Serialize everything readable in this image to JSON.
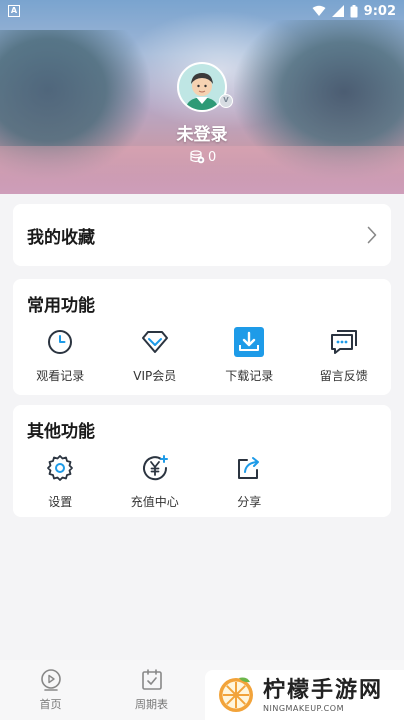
{
  "status_bar": {
    "time": "9:02",
    "left_icon_letter": "A",
    "icons": [
      "notification-A-icon",
      "wifi-icon",
      "signal-icon",
      "battery-icon"
    ]
  },
  "profile": {
    "username": "未登录",
    "coin_count": "0",
    "avatar_badge": "V"
  },
  "favorites": {
    "title": "我的收藏"
  },
  "common_functions": {
    "title": "常用功能",
    "items": [
      {
        "label": "观看记录",
        "icon": "clock-icon"
      },
      {
        "label": "VIP会员",
        "icon": "diamond-icon"
      },
      {
        "label": "下载记录",
        "icon": "download-icon"
      },
      {
        "label": "留言反馈",
        "icon": "message-icon"
      }
    ]
  },
  "other_functions": {
    "title": "其他功能",
    "items": [
      {
        "label": "设置",
        "icon": "gear-icon"
      },
      {
        "label": "充值中心",
        "icon": "yen-recharge-icon"
      },
      {
        "label": "分享",
        "icon": "share-icon"
      }
    ]
  },
  "bottom_nav": {
    "items": [
      {
        "label": "首页",
        "icon": "home-play-icon"
      },
      {
        "label": "周期表",
        "icon": "calendar-icon"
      }
    ]
  },
  "watermark": {
    "title": "柠檬手游网",
    "subtitle": "NINGMAKEUP.COM"
  },
  "colors": {
    "accent_blue": "#1e9be8",
    "icon_dark": "#2b3440",
    "background": "#f4f4f6",
    "card": "#ffffff"
  }
}
